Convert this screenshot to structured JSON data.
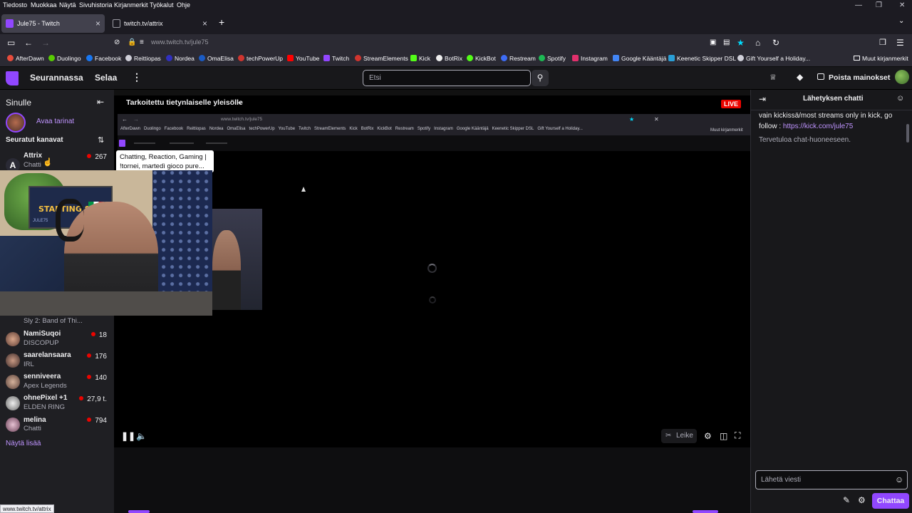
{
  "menubar": {
    "items": [
      "Tiedosto",
      "Muokkaa",
      "Näytä",
      "Sivuhistoria",
      "Kirjanmerkit",
      "Työkalut",
      "Ohje"
    ]
  },
  "tabs": [
    {
      "title": "Jule75 - Twitch",
      "active": true
    },
    {
      "title": "twitch.tv/attrix",
      "active": false
    }
  ],
  "navbar": {
    "url": "www.twitch.tv/jule75"
  },
  "bookmarks": [
    {
      "label": "AfterDawn",
      "color": "#e74c3c"
    },
    {
      "label": "Duolingo",
      "color": "#58cc02"
    },
    {
      "label": "Facebook",
      "color": "#1877f2"
    },
    {
      "label": "Reittiopas",
      "color": "#cfcfd8"
    },
    {
      "label": "Nordea",
      "color": "#0000a0"
    },
    {
      "label": "OmaElisa",
      "color": "#1a5bc4"
    },
    {
      "label": "techPowerUp",
      "color": "#d0352f"
    },
    {
      "label": "YouTube",
      "color": "#ff0000"
    },
    {
      "label": "Twitch",
      "color": "#9146ff"
    },
    {
      "label": "StreamElements",
      "color": "#d0352f"
    },
    {
      "label": "Kick",
      "color": "#53fc18"
    },
    {
      "label": "BotRix",
      "color": "#eeeeee"
    },
    {
      "label": "KickBot",
      "color": "#53fc18"
    },
    {
      "label": "Restream",
      "color": "#3d6cf5"
    },
    {
      "label": "Spotify",
      "color": "#1db954"
    },
    {
      "label": "Instagram",
      "color": "#e1306c"
    },
    {
      "label": "Google Kääntäjä",
      "color": "#4285f4"
    },
    {
      "label": "Keenetic Skipper DSL",
      "color": "#2a9fd6"
    },
    {
      "label": "Gift Yourself a Holiday...",
      "color": "#cfcfd8"
    }
  ],
  "bookmarks_other": "Muut kirjanmerkit",
  "twitch_nav": {
    "following": "Seurannassa",
    "browse": "Selaa",
    "search_placeholder": "Etsi",
    "remove_ads": "Poista mainokset"
  },
  "sidebar": {
    "for_you": "Sinulle",
    "stories": "Avaa tarinat",
    "followed_header": "Seuratut kanavat",
    "show_more": "Näytä lisää",
    "channels": [
      {
        "name": "Attrix",
        "game": "Chatti",
        "viewers": "267"
      },
      {
        "name": "",
        "game": "Sly 2: Band of Thi...",
        "viewers": ""
      },
      {
        "name": "NamiSuqoi",
        "game": "DISCOPUP",
        "viewers": "18"
      },
      {
        "name": "saarelansaara",
        "game": "IRL",
        "viewers": "176"
      },
      {
        "name": "senniveera",
        "game": "Apex Legends",
        "viewers": "140"
      },
      {
        "name": "ohnePixel +1",
        "game": "ELDEN RING",
        "viewers": "27,9 t."
      },
      {
        "name": "melina",
        "game": "Chatti",
        "viewers": "794"
      }
    ]
  },
  "tooltip": {
    "line1": "Chatting, Reaction, Gaming |",
    "line2": "!tornei, martedì gioco pure..."
  },
  "player": {
    "audience_label": "Tarkoitettu tietynlaiselle yleisölle",
    "live": "LIVE",
    "clip": "Leike"
  },
  "inner_browser": {
    "url": "www.twitch.tv/jule75",
    "bookmarks": [
      "AfterDawn",
      "Duolingo",
      "Facebook",
      "Reittiopas",
      "Nordea",
      "OmaElisa",
      "techPowerUp",
      "YouTube",
      "Twitch",
      "StreamElements",
      "Kick",
      "BotRix",
      "KickBot",
      "Restream",
      "Spotify",
      "Instagram",
      "Google Kääntäjä",
      "Keenetic Skipper DSL",
      "Gift Yourself a Holiday..."
    ],
    "other": "Muut kirjanmerkit"
  },
  "webcam": {
    "screen_text": "STARTING SOON",
    "screen_small": "JULE75"
  },
  "chat": {
    "title": "Lähetyksen chatti",
    "message_text": "vain kickissä/most streams only in kick, go follow : ",
    "message_link": "https://kick.com/jule75",
    "welcome": "Tervetuloa chat-huoneeseen.",
    "input_placeholder": "Lähetä viesti",
    "send": "Chattaa"
  },
  "status_url": "www.twitch.tv/attrix",
  "colors": {
    "twitch_purple": "#9147ff",
    "live_red": "#eb0400",
    "link": "#bf94ff"
  }
}
